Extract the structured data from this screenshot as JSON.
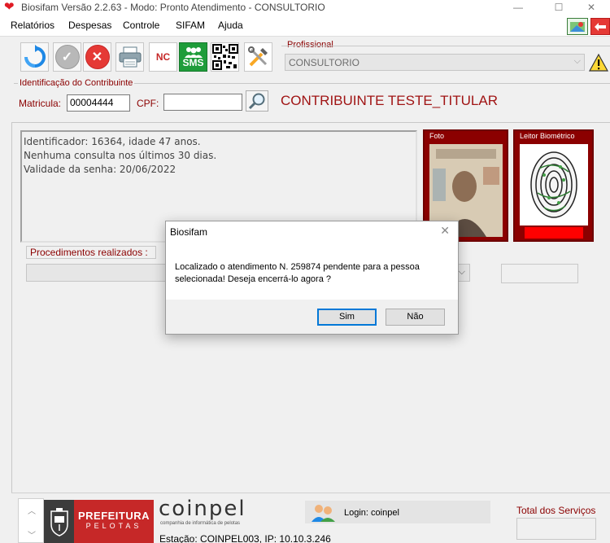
{
  "window": {
    "title": "Biosifam Versão 2.2.63 - Modo: Pronto Atendimento - CONSULTORIO",
    "minimize": "—",
    "maximize": "☐",
    "close": "✕"
  },
  "menu": [
    "Relatórios",
    "Despesas",
    "Controle",
    "SIFAM",
    "Ajuda"
  ],
  "toolbar": {
    "nc_label": "NC",
    "sms_label": "SMS"
  },
  "profissional": {
    "label": "Profissional",
    "value": "CONSULTORIO"
  },
  "identificacao": {
    "label": "Identificação do Contribuinte",
    "matricula_label": "Matricula:",
    "matricula_value": "00004444",
    "cpf_label": "CPF:",
    "cpf_value": "",
    "contribuinte_name": "CONTRIBUINTE TESTE_TITULAR"
  },
  "info": {
    "line1": "Identificador: 16364, idade 47 anos.",
    "line2": "Nenhuma consulta nos últimos 30 dias.",
    "line3": "Validade da senha: 20/06/2022"
  },
  "foto": {
    "label": "Foto"
  },
  "leitor": {
    "label": "Leitor Biométrico"
  },
  "procedimentos": {
    "label": "Procedimentos realizados :"
  },
  "dialog": {
    "title": "Biosifam",
    "message": "Localizado o atendimento N. 259874 pendente para a pessoa selecionada! Deseja encerrá-lo agora ?",
    "yes": "Sim",
    "no": "Não"
  },
  "footer": {
    "prefeitura_line1": "PREFEITURA",
    "prefeitura_line2": "PELOTAS",
    "coinpel": "coinpel",
    "coinpel_sub": "companhia de informática de pelotas",
    "login": "Login: coinpel",
    "estacao": "Estação: COINPEL003, IP: 10.10.3.246",
    "total_servicos": "Total dos Serviços"
  },
  "colors": {
    "accent_dark_red": "#8b0000",
    "name_red": "#a01414",
    "sms_green": "#1f9c3a",
    "prefeitura_red": "#c62828",
    "dialog_focus_blue": "#0078d7"
  }
}
